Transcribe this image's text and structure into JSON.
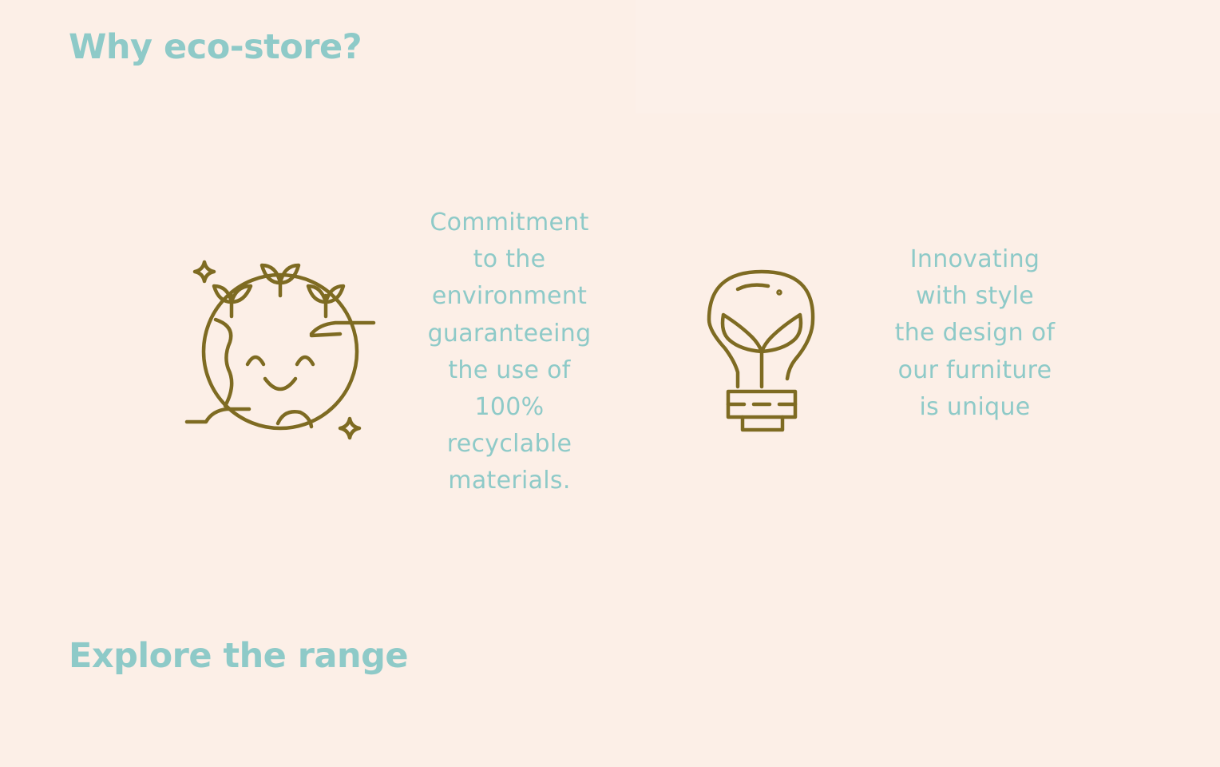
{
  "why_section": {
    "title": "Why eco-store?",
    "features": [
      {
        "icon": "smiling-earth-icon",
        "text": "Commitment to the environment guaranteeing the use of 100% recyclable materials."
      },
      {
        "icon": "lightbulb-sprout-icon",
        "text": "Innovating with style the design of our furniture is unique"
      }
    ]
  },
  "range_section": {
    "title": "Explore the range"
  },
  "colors": {
    "background": "#fcefe7",
    "heading": "#8ecac8",
    "icon": "#7e6b22"
  }
}
